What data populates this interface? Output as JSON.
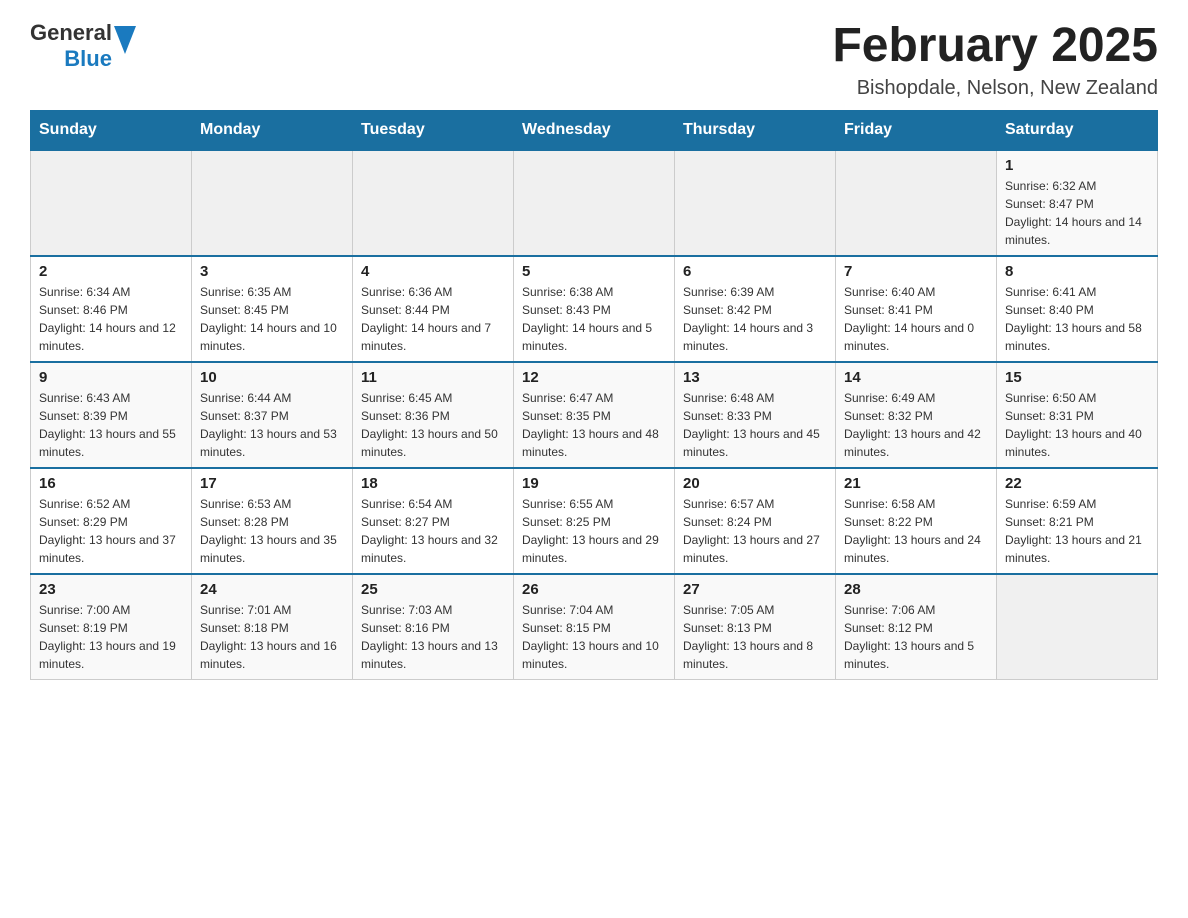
{
  "header": {
    "logo": {
      "general": "General",
      "arrow": "▶",
      "blue": "Blue"
    },
    "title": "February 2025",
    "location": "Bishopdale, Nelson, New Zealand"
  },
  "weekdays": [
    "Sunday",
    "Monday",
    "Tuesday",
    "Wednesday",
    "Thursday",
    "Friday",
    "Saturday"
  ],
  "weeks": [
    [
      {
        "day": "",
        "info": ""
      },
      {
        "day": "",
        "info": ""
      },
      {
        "day": "",
        "info": ""
      },
      {
        "day": "",
        "info": ""
      },
      {
        "day": "",
        "info": ""
      },
      {
        "day": "",
        "info": ""
      },
      {
        "day": "1",
        "info": "Sunrise: 6:32 AM\nSunset: 8:47 PM\nDaylight: 14 hours and 14 minutes."
      }
    ],
    [
      {
        "day": "2",
        "info": "Sunrise: 6:34 AM\nSunset: 8:46 PM\nDaylight: 14 hours and 12 minutes."
      },
      {
        "day": "3",
        "info": "Sunrise: 6:35 AM\nSunset: 8:45 PM\nDaylight: 14 hours and 10 minutes."
      },
      {
        "day": "4",
        "info": "Sunrise: 6:36 AM\nSunset: 8:44 PM\nDaylight: 14 hours and 7 minutes."
      },
      {
        "day": "5",
        "info": "Sunrise: 6:38 AM\nSunset: 8:43 PM\nDaylight: 14 hours and 5 minutes."
      },
      {
        "day": "6",
        "info": "Sunrise: 6:39 AM\nSunset: 8:42 PM\nDaylight: 14 hours and 3 minutes."
      },
      {
        "day": "7",
        "info": "Sunrise: 6:40 AM\nSunset: 8:41 PM\nDaylight: 14 hours and 0 minutes."
      },
      {
        "day": "8",
        "info": "Sunrise: 6:41 AM\nSunset: 8:40 PM\nDaylight: 13 hours and 58 minutes."
      }
    ],
    [
      {
        "day": "9",
        "info": "Sunrise: 6:43 AM\nSunset: 8:39 PM\nDaylight: 13 hours and 55 minutes."
      },
      {
        "day": "10",
        "info": "Sunrise: 6:44 AM\nSunset: 8:37 PM\nDaylight: 13 hours and 53 minutes."
      },
      {
        "day": "11",
        "info": "Sunrise: 6:45 AM\nSunset: 8:36 PM\nDaylight: 13 hours and 50 minutes."
      },
      {
        "day": "12",
        "info": "Sunrise: 6:47 AM\nSunset: 8:35 PM\nDaylight: 13 hours and 48 minutes."
      },
      {
        "day": "13",
        "info": "Sunrise: 6:48 AM\nSunset: 8:33 PM\nDaylight: 13 hours and 45 minutes."
      },
      {
        "day": "14",
        "info": "Sunrise: 6:49 AM\nSunset: 8:32 PM\nDaylight: 13 hours and 42 minutes."
      },
      {
        "day": "15",
        "info": "Sunrise: 6:50 AM\nSunset: 8:31 PM\nDaylight: 13 hours and 40 minutes."
      }
    ],
    [
      {
        "day": "16",
        "info": "Sunrise: 6:52 AM\nSunset: 8:29 PM\nDaylight: 13 hours and 37 minutes."
      },
      {
        "day": "17",
        "info": "Sunrise: 6:53 AM\nSunset: 8:28 PM\nDaylight: 13 hours and 35 minutes."
      },
      {
        "day": "18",
        "info": "Sunrise: 6:54 AM\nSunset: 8:27 PM\nDaylight: 13 hours and 32 minutes."
      },
      {
        "day": "19",
        "info": "Sunrise: 6:55 AM\nSunset: 8:25 PM\nDaylight: 13 hours and 29 minutes."
      },
      {
        "day": "20",
        "info": "Sunrise: 6:57 AM\nSunset: 8:24 PM\nDaylight: 13 hours and 27 minutes."
      },
      {
        "day": "21",
        "info": "Sunrise: 6:58 AM\nSunset: 8:22 PM\nDaylight: 13 hours and 24 minutes."
      },
      {
        "day": "22",
        "info": "Sunrise: 6:59 AM\nSunset: 8:21 PM\nDaylight: 13 hours and 21 minutes."
      }
    ],
    [
      {
        "day": "23",
        "info": "Sunrise: 7:00 AM\nSunset: 8:19 PM\nDaylight: 13 hours and 19 minutes."
      },
      {
        "day": "24",
        "info": "Sunrise: 7:01 AM\nSunset: 8:18 PM\nDaylight: 13 hours and 16 minutes."
      },
      {
        "day": "25",
        "info": "Sunrise: 7:03 AM\nSunset: 8:16 PM\nDaylight: 13 hours and 13 minutes."
      },
      {
        "day": "26",
        "info": "Sunrise: 7:04 AM\nSunset: 8:15 PM\nDaylight: 13 hours and 10 minutes."
      },
      {
        "day": "27",
        "info": "Sunrise: 7:05 AM\nSunset: 8:13 PM\nDaylight: 13 hours and 8 minutes."
      },
      {
        "day": "28",
        "info": "Sunrise: 7:06 AM\nSunset: 8:12 PM\nDaylight: 13 hours and 5 minutes."
      },
      {
        "day": "",
        "info": ""
      }
    ]
  ]
}
